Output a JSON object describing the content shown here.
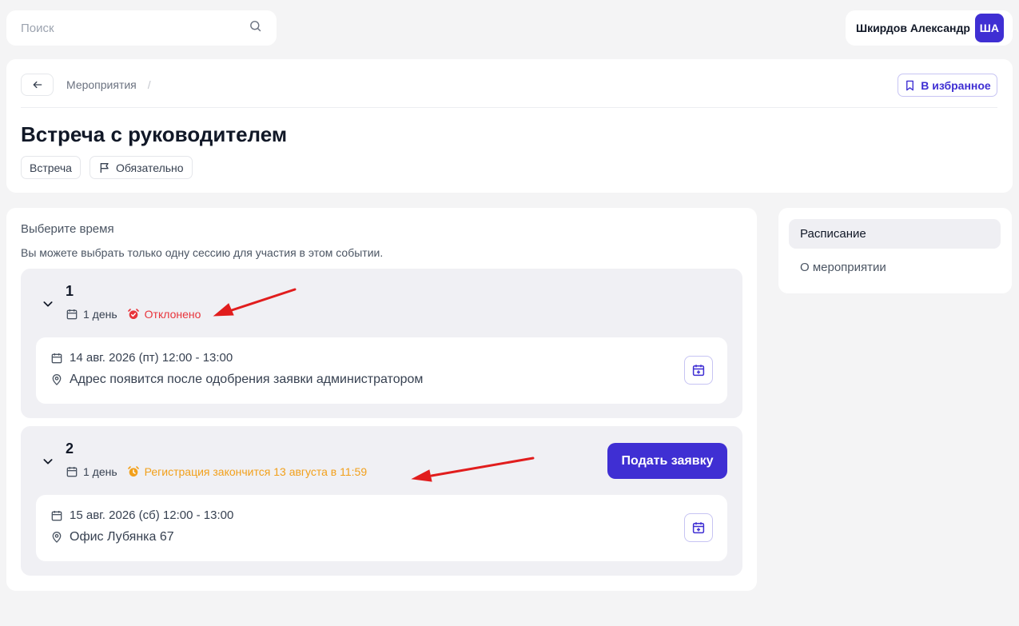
{
  "search": {
    "placeholder": "Поиск"
  },
  "user": {
    "name": "Шкирдов Александр",
    "initials": "ША"
  },
  "header": {
    "breadcrumb": "Мероприятия",
    "breadcrumb_sep": "/",
    "favorite_label": "В избранное",
    "title": "Встреча с руководителем",
    "tags": [
      "Встреча",
      "Обязательно"
    ]
  },
  "main": {
    "title": "Выберите время",
    "subtitle": "Вы можете выбрать только одну сессию для участия в этом событии.",
    "sessions": [
      {
        "number": "1",
        "duration": "1 день",
        "status": "Отклонено",
        "status_color": "#e8343b",
        "date": "14 авг. 2026 (пт) 12:00 - 13:00",
        "address": "Адрес появится после одобрения заявки администратором"
      },
      {
        "number": "2",
        "duration": "1 день",
        "status": "Регистрация закончится 13 августа в 11:59",
        "status_color": "#f2a01b",
        "apply_label": "Подать заявку",
        "date": "15 авг. 2026 (сб) 12:00 - 13:00",
        "address": "Офис Лубянка 67"
      }
    ]
  },
  "sidebar": {
    "items": [
      {
        "label": "Расписание",
        "active": true
      },
      {
        "label": "О мероприятии",
        "active": false
      }
    ]
  },
  "colors": {
    "accent": "#3f2fd3",
    "annotation_arrow": "#e11d1d"
  }
}
